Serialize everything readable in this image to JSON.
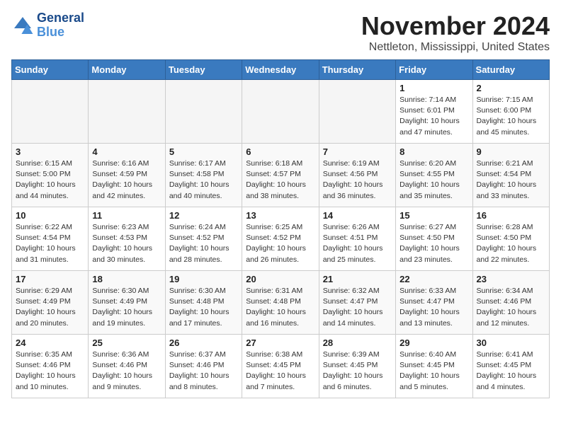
{
  "header": {
    "logo_line1": "General",
    "logo_line2": "Blue",
    "month": "November 2024",
    "location": "Nettleton, Mississippi, United States"
  },
  "weekdays": [
    "Sunday",
    "Monday",
    "Tuesday",
    "Wednesday",
    "Thursday",
    "Friday",
    "Saturday"
  ],
  "weeks": [
    [
      {
        "day": "",
        "info": ""
      },
      {
        "day": "",
        "info": ""
      },
      {
        "day": "",
        "info": ""
      },
      {
        "day": "",
        "info": ""
      },
      {
        "day": "",
        "info": ""
      },
      {
        "day": "1",
        "info": "Sunrise: 7:14 AM\nSunset: 6:01 PM\nDaylight: 10 hours\nand 47 minutes."
      },
      {
        "day": "2",
        "info": "Sunrise: 7:15 AM\nSunset: 6:00 PM\nDaylight: 10 hours\nand 45 minutes."
      }
    ],
    [
      {
        "day": "3",
        "info": "Sunrise: 6:15 AM\nSunset: 5:00 PM\nDaylight: 10 hours\nand 44 minutes."
      },
      {
        "day": "4",
        "info": "Sunrise: 6:16 AM\nSunset: 4:59 PM\nDaylight: 10 hours\nand 42 minutes."
      },
      {
        "day": "5",
        "info": "Sunrise: 6:17 AM\nSunset: 4:58 PM\nDaylight: 10 hours\nand 40 minutes."
      },
      {
        "day": "6",
        "info": "Sunrise: 6:18 AM\nSunset: 4:57 PM\nDaylight: 10 hours\nand 38 minutes."
      },
      {
        "day": "7",
        "info": "Sunrise: 6:19 AM\nSunset: 4:56 PM\nDaylight: 10 hours\nand 36 minutes."
      },
      {
        "day": "8",
        "info": "Sunrise: 6:20 AM\nSunset: 4:55 PM\nDaylight: 10 hours\nand 35 minutes."
      },
      {
        "day": "9",
        "info": "Sunrise: 6:21 AM\nSunset: 4:54 PM\nDaylight: 10 hours\nand 33 minutes."
      }
    ],
    [
      {
        "day": "10",
        "info": "Sunrise: 6:22 AM\nSunset: 4:54 PM\nDaylight: 10 hours\nand 31 minutes."
      },
      {
        "day": "11",
        "info": "Sunrise: 6:23 AM\nSunset: 4:53 PM\nDaylight: 10 hours\nand 30 minutes."
      },
      {
        "day": "12",
        "info": "Sunrise: 6:24 AM\nSunset: 4:52 PM\nDaylight: 10 hours\nand 28 minutes."
      },
      {
        "day": "13",
        "info": "Sunrise: 6:25 AM\nSunset: 4:52 PM\nDaylight: 10 hours\nand 26 minutes."
      },
      {
        "day": "14",
        "info": "Sunrise: 6:26 AM\nSunset: 4:51 PM\nDaylight: 10 hours\nand 25 minutes."
      },
      {
        "day": "15",
        "info": "Sunrise: 6:27 AM\nSunset: 4:50 PM\nDaylight: 10 hours\nand 23 minutes."
      },
      {
        "day": "16",
        "info": "Sunrise: 6:28 AM\nSunset: 4:50 PM\nDaylight: 10 hours\nand 22 minutes."
      }
    ],
    [
      {
        "day": "17",
        "info": "Sunrise: 6:29 AM\nSunset: 4:49 PM\nDaylight: 10 hours\nand 20 minutes."
      },
      {
        "day": "18",
        "info": "Sunrise: 6:30 AM\nSunset: 4:49 PM\nDaylight: 10 hours\nand 19 minutes."
      },
      {
        "day": "19",
        "info": "Sunrise: 6:30 AM\nSunset: 4:48 PM\nDaylight: 10 hours\nand 17 minutes."
      },
      {
        "day": "20",
        "info": "Sunrise: 6:31 AM\nSunset: 4:48 PM\nDaylight: 10 hours\nand 16 minutes."
      },
      {
        "day": "21",
        "info": "Sunrise: 6:32 AM\nSunset: 4:47 PM\nDaylight: 10 hours\nand 14 minutes."
      },
      {
        "day": "22",
        "info": "Sunrise: 6:33 AM\nSunset: 4:47 PM\nDaylight: 10 hours\nand 13 minutes."
      },
      {
        "day": "23",
        "info": "Sunrise: 6:34 AM\nSunset: 4:46 PM\nDaylight: 10 hours\nand 12 minutes."
      }
    ],
    [
      {
        "day": "24",
        "info": "Sunrise: 6:35 AM\nSunset: 4:46 PM\nDaylight: 10 hours\nand 10 minutes."
      },
      {
        "day": "25",
        "info": "Sunrise: 6:36 AM\nSunset: 4:46 PM\nDaylight: 10 hours\nand 9 minutes."
      },
      {
        "day": "26",
        "info": "Sunrise: 6:37 AM\nSunset: 4:46 PM\nDaylight: 10 hours\nand 8 minutes."
      },
      {
        "day": "27",
        "info": "Sunrise: 6:38 AM\nSunset: 4:45 PM\nDaylight: 10 hours\nand 7 minutes."
      },
      {
        "day": "28",
        "info": "Sunrise: 6:39 AM\nSunset: 4:45 PM\nDaylight: 10 hours\nand 6 minutes."
      },
      {
        "day": "29",
        "info": "Sunrise: 6:40 AM\nSunset: 4:45 PM\nDaylight: 10 hours\nand 5 minutes."
      },
      {
        "day": "30",
        "info": "Sunrise: 6:41 AM\nSunset: 4:45 PM\nDaylight: 10 hours\nand 4 minutes."
      }
    ]
  ]
}
